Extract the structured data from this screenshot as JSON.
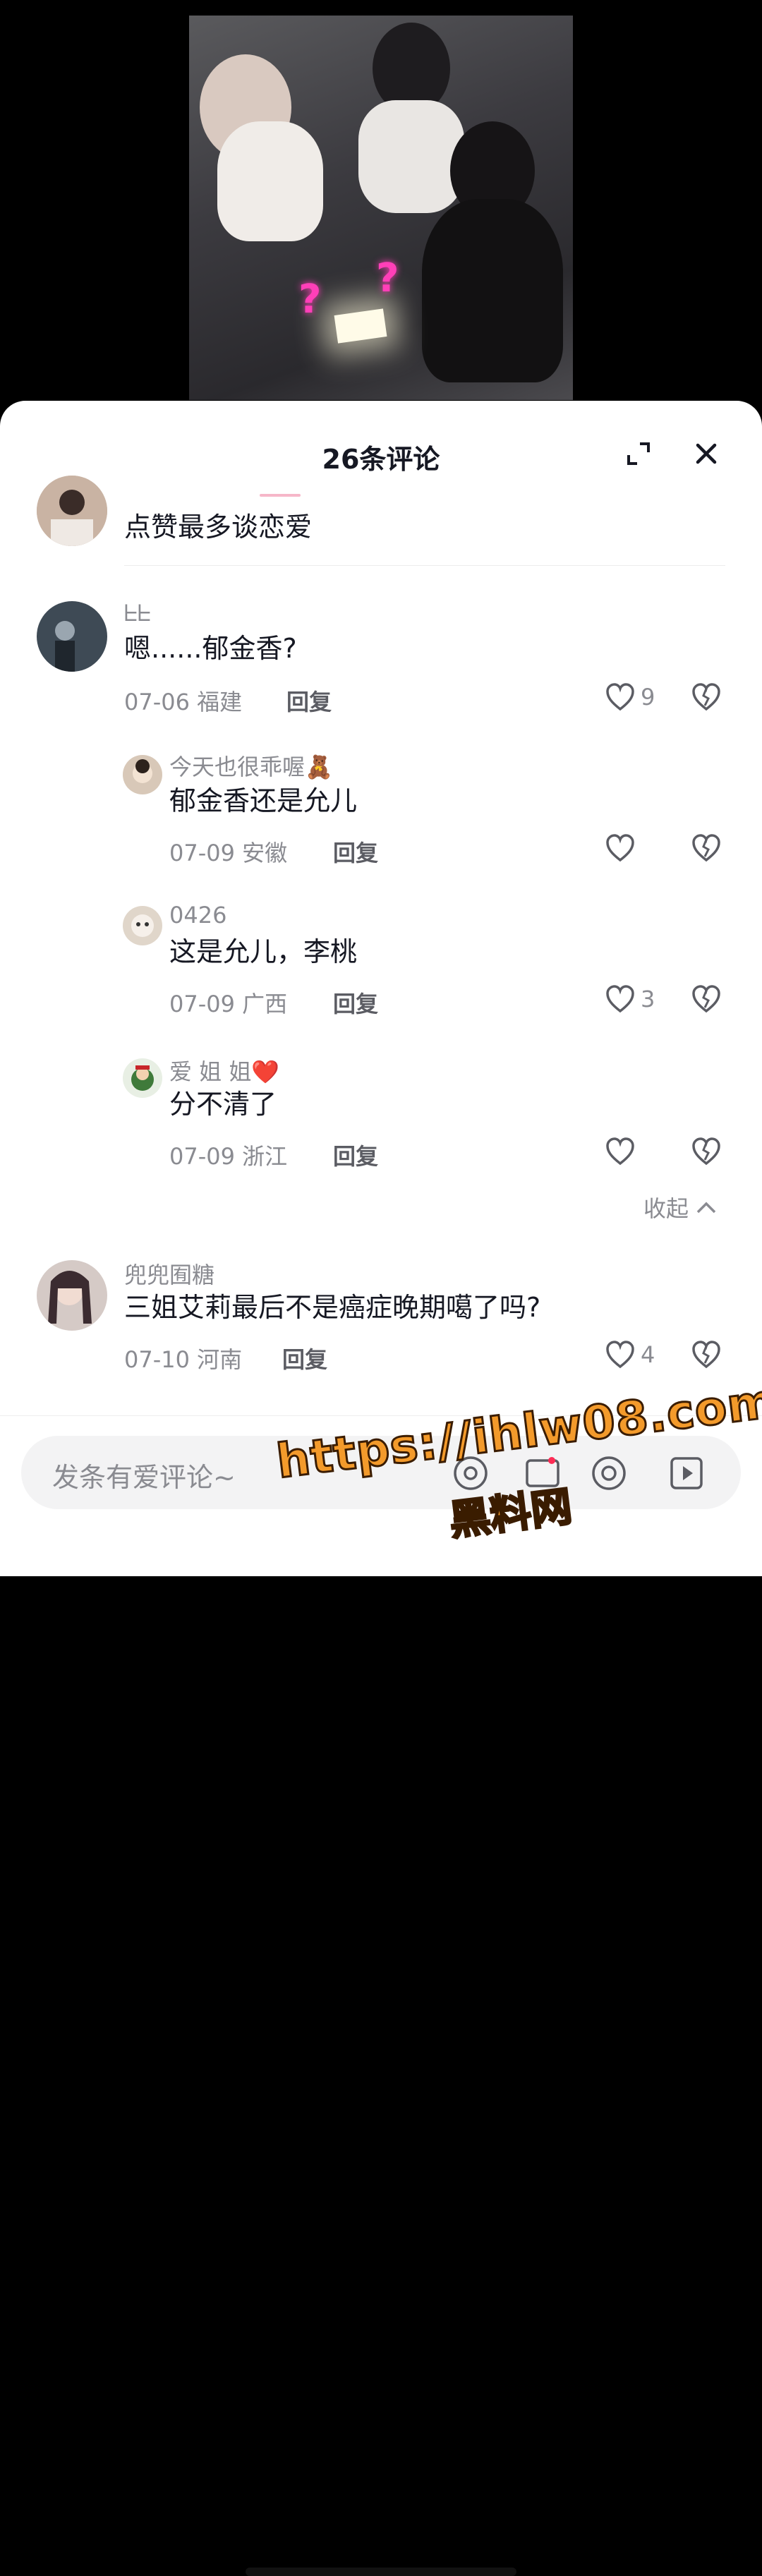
{
  "header": {
    "title": "26条评论"
  },
  "comments": [
    {
      "content": "点赞最多谈恋爱",
      "avatar_color": "#c9b3a3"
    },
    {
      "username": "ᖶᖶ",
      "content": "嗯......郁金香?",
      "date": "07-06",
      "location": "福建",
      "reply_label": "回复",
      "likes": "9",
      "avatar_color": "#3e4a55",
      "replies": [
        {
          "username": "今天也很乖喔🧸",
          "content": "郁金香还是允儿",
          "date": "07-09",
          "location": "安徽",
          "reply_label": "回复",
          "likes": "",
          "avatar_color": "#d8c8b8"
        },
        {
          "username": "0426",
          "content": "这是允儿，李桃",
          "date": "07-09",
          "location": "广西",
          "reply_label": "回复",
          "likes": "3",
          "avatar_color": "#e0d6ca"
        },
        {
          "username": "爱 姐 姐❤️",
          "content": "分不清了",
          "date": "07-09",
          "location": "浙江",
          "reply_label": "回复",
          "likes": "",
          "avatar_color": "#3f7a3a"
        }
      ]
    },
    {
      "username": "兜兜囿糖",
      "content": "三姐艾莉最后不是癌症晚期噶了吗?",
      "date": "07-10",
      "location": "河南",
      "reply_label": "回复",
      "likes": "4",
      "avatar_color": "#b9a7a2"
    }
  ],
  "collapse_label": "收起",
  "input": {
    "placeholder": "发条有爱评论~"
  },
  "watermark": {
    "url": "https://ihlw08.com",
    "name": "黑料网"
  },
  "icons": [
    "expand-icon",
    "close-icon",
    "heart-icon",
    "broken-heart-icon",
    "chevron-up-icon",
    "at-icon",
    "image-icon",
    "emoji-icon",
    "play-icon"
  ],
  "colors": {
    "text": "#161823",
    "muted": "#8a8b91",
    "background": "#ffffff",
    "pink": "#f6b7c9",
    "watermark": "#f39a2b"
  }
}
